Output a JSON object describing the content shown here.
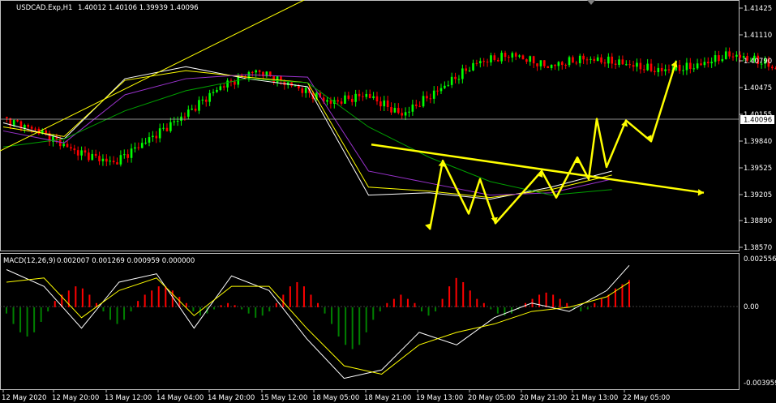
{
  "header": {
    "symbol_title": "USDCAD.Exp,H1",
    "ohlc_text": "1.40012 1.40106 1.39939 1.40096"
  },
  "macd_header": {
    "label": "MACD(12,26,9)",
    "values_text": "0.002007 0.001269 0.000959 0.000000"
  },
  "price_axis": {
    "ticks": [
      "1.41425",
      "1.41110",
      "1.40790",
      "1.40475",
      "1.40155",
      "1.39840",
      "1.39525",
      "1.39205",
      "1.38890",
      "1.38570"
    ],
    "current_price": "1.40096"
  },
  "macd_axis": {
    "ticks": [
      "0.002556",
      "0.00",
      "-0.003959"
    ]
  },
  "time_axis": {
    "labels": [
      "12 May 2020",
      "12 May 20:00",
      "13 May 12:00",
      "14 May 04:00",
      "14 May 20:00",
      "15 May 12:00",
      "18 May 05:00",
      "18 May 21:00",
      "19 May 13:00",
      "20 May 05:00",
      "20 May 21:00",
      "21 May 13:00",
      "22 May 05:00"
    ]
  },
  "colors": {
    "background": "#000000",
    "bull_candle": "#00ff00",
    "bear_candle": "#ff0000",
    "hist_positive": "#ff0000",
    "hist_negative": "#008000",
    "ma_fast": "#ffffff",
    "ma_mid": "#ffff00",
    "ma_purple": "#9932cc",
    "ma_slow": "#00a000",
    "annotation": "#ffff00",
    "axis_text": "#ffffff",
    "grid": "#c0c0c0"
  },
  "chart_data": [
    {
      "type": "candlestick",
      "title": "USDCAD.Exp,H1",
      "x_labels": [
        "12 May 2020",
        "12 May 20:00",
        "13 May 12:00",
        "14 May 04:00",
        "14 May 20:00",
        "15 May 12:00",
        "18 May 05:00",
        "18 May 21:00",
        "19 May 13:00",
        "20 May 05:00",
        "20 May 21:00",
        "21 May 13:00",
        "22 May 05:00"
      ],
      "ylim": [
        1.3845,
        1.4158
      ],
      "last_ohlc": {
        "open": 1.40012,
        "high": 1.40106,
        "low": 1.39939,
        "close": 1.40096
      },
      "close_path": [
        [
          0,
          1.401
        ],
        [
          2,
          1.3995
        ],
        [
          4,
          1.397
        ],
        [
          6,
          1.3955
        ],
        [
          8,
          1.3985
        ],
        [
          10,
          1.4015
        ],
        [
          12,
          1.405
        ],
        [
          14,
          1.407
        ],
        [
          16,
          1.405
        ],
        [
          18,
          1.403
        ],
        [
          20,
          1.404
        ],
        [
          22,
          1.4015
        ],
        [
          24,
          1.4045
        ],
        [
          26,
          1.408
        ],
        [
          28,
          1.409
        ],
        [
          30,
          1.4075
        ],
        [
          32,
          1.4085
        ],
        [
          34,
          1.408
        ],
        [
          36,
          1.407
        ],
        [
          38,
          1.4075
        ],
        [
          40,
          1.409
        ],
        [
          42,
          1.408
        ],
        [
          44,
          1.405
        ],
        [
          46,
          1.402
        ],
        [
          48,
          1.4015
        ],
        [
          50,
          1.403
        ],
        [
          52,
          1.402
        ],
        [
          54,
          1.4025
        ],
        [
          56,
          1.4015
        ],
        [
          58,
          1.404
        ],
        [
          60,
          1.4065
        ],
        [
          62,
          1.409
        ],
        [
          64,
          1.4105
        ],
        [
          66,
          1.4085
        ],
        [
          68,
          1.407
        ],
        [
          70,
          1.4065
        ],
        [
          72,
          1.4055
        ],
        [
          74,
          1.406
        ],
        [
          76,
          1.404
        ],
        [
          78,
          1.3985
        ],
        [
          80,
          1.395
        ],
        [
          82,
          1.3925
        ],
        [
          84,
          1.3935
        ],
        [
          86,
          1.3945
        ],
        [
          88,
          1.3915
        ],
        [
          90,
          1.3895
        ],
        [
          92,
          1.387
        ],
        [
          94,
          1.388
        ],
        [
          96,
          1.3955
        ],
        [
          98,
          1.394
        ],
        [
          100,
          1.3915
        ],
        [
          102,
          1.3925
        ],
        [
          104,
          1.393
        ],
        [
          106,
          1.392
        ],
        [
          108,
          1.3905
        ],
        [
          110,
          1.3885
        ],
        [
          112,
          1.3878
        ],
        [
          114,
          1.3895
        ],
        [
          116,
          1.3905
        ],
        [
          118,
          1.39
        ],
        [
          120,
          1.3915
        ],
        [
          122,
          1.393
        ],
        [
          124,
          1.3938
        ],
        [
          126,
          1.3925
        ],
        [
          128,
          1.391
        ],
        [
          130,
          1.39
        ],
        [
          132,
          1.393
        ],
        [
          134,
          1.3955
        ],
        [
          136,
          1.3948
        ],
        [
          138,
          1.3942
        ],
        [
          140,
          1.3955
        ],
        [
          142,
          1.396
        ],
        [
          144,
          1.3985
        ],
        [
          146,
          1.401
        ]
      ],
      "moving_averages": [
        {
          "color": "ma_fast",
          "points": [
            [
              0,
              1.4005
            ],
            [
              20,
              1.3985
            ],
            [
              40,
              1.406
            ],
            [
              60,
              1.4075
            ],
            [
              80,
              1.406
            ],
            [
              100,
              1.405
            ],
            [
              120,
              1.3915
            ],
            [
              140,
              1.3918
            ],
            [
              160,
              1.391
            ],
            [
              180,
              1.3925
            ],
            [
              200,
              1.3945
            ]
          ]
        },
        {
          "color": "ma_mid",
          "points": [
            [
              0,
              1.4
            ],
            [
              20,
              1.3988
            ],
            [
              40,
              1.4058
            ],
            [
              60,
              1.407
            ],
            [
              80,
              1.4062
            ],
            [
              100,
              1.4055
            ],
            [
              120,
              1.3925
            ],
            [
              140,
              1.392
            ],
            [
              160,
              1.3912
            ],
            [
              180,
              1.3922
            ],
            [
              200,
              1.394
            ]
          ]
        },
        {
          "color": "ma_purple",
          "points": [
            [
              0,
              1.3995
            ],
            [
              20,
              1.398
            ],
            [
              40,
              1.404
            ],
            [
              60,
              1.406
            ],
            [
              80,
              1.4065
            ],
            [
              100,
              1.4062
            ],
            [
              120,
              1.3945
            ],
            [
              140,
              1.393
            ],
            [
              160,
              1.3915
            ],
            [
              180,
              1.3918
            ],
            [
              200,
              1.3935
            ]
          ]
        },
        {
          "color": "ma_slow",
          "points": [
            [
              0,
              1.3975
            ],
            [
              20,
              1.3985
            ],
            [
              40,
              1.402
            ],
            [
              60,
              1.4045
            ],
            [
              80,
              1.406
            ],
            [
              100,
              1.4055
            ],
            [
              120,
              1.4
            ],
            [
              140,
              1.3962
            ],
            [
              160,
              1.3932
            ],
            [
              180,
              1.3915
            ],
            [
              200,
              1.3922
            ]
          ]
        }
      ],
      "trendlines": [
        {
          "color": "ma_mid",
          "from": [
            0,
            1.397
          ],
          "to": [
            77,
            1.4158
          ]
        },
        {
          "color": "annotation",
          "from": [
            94,
            1.3978
          ],
          "to": [
            178,
            1.3918
          ]
        }
      ],
      "wave_pattern": [
        [
          106,
          1.3872
        ],
        [
          112,
          1.3958
        ],
        [
          119,
          1.3892
        ],
        [
          123,
          1.3935
        ],
        [
          125,
          1.388
        ],
        [
          137,
          1.3945
        ],
        [
          141,
          1.3912
        ],
        [
          145,
          1.3962
        ],
        [
          150,
          1.3935
        ],
        [
          154,
          1.401
        ],
        [
          157,
          1.395
        ],
        [
          160,
          1.4008
        ],
        [
          165,
          1.3982
        ],
        [
          171,
          1.4082
        ]
      ],
      "horizontal_line": 1.40096
    },
    {
      "type": "bar",
      "title": "MACD(12,26,9)",
      "values_text": "0.002007 0.001269 0.000959 0.000000",
      "ylim": [
        -0.003959,
        0.002556
      ],
      "histogram": [
        -0.0003,
        -0.0008,
        -0.0012,
        -0.0014,
        -0.0012,
        -0.0007,
        -0.0002,
        0.0003,
        0.0006,
        0.0008,
        0.001,
        0.0009,
        0.0006,
        0.0002,
        -0.0002,
        -0.0006,
        -0.0008,
        -0.0006,
        -0.0002,
        0.0003,
        0.0006,
        0.0008,
        0.001,
        0.001,
        0.0008,
        0.0005,
        0.0002,
        -0.0002,
        -0.0004,
        -0.0003,
        -0.0001,
        0.0001,
        0.0002,
        0.0001,
        -0.0001,
        -0.0003,
        -0.0005,
        -0.0004,
        -0.0002,
        0.0002,
        0.0006,
        0.001,
        0.0012,
        0.001,
        0.0006,
        0.0002,
        -0.0003,
        -0.0008,
        -0.0014,
        -0.0018,
        -0.002,
        -0.0018,
        -0.0012,
        -0.0006,
        -0.0002,
        0.0002,
        0.0004,
        0.0006,
        0.0004,
        0.0002,
        -0.0002,
        -0.0004,
        -0.0002,
        0.0004,
        0.001,
        0.0014,
        0.0012,
        0.0008,
        0.0004,
        0.0002,
        -0.0001,
        -0.0003,
        -0.0004,
        -0.0003,
        -0.0001,
        0.0002,
        0.0004,
        0.0006,
        0.0007,
        0.0006,
        0.0004,
        0.0002,
        -0.0001,
        -0.0002,
        -0.0001,
        0.0002,
        0.0004,
        0.0006,
        0.0009,
        0.0011,
        0.0013
      ],
      "macd_line": [
        [
          0,
          0.0018
        ],
        [
          10,
          0.001
        ],
        [
          20,
          -0.001
        ],
        [
          30,
          0.0012
        ],
        [
          40,
          0.0016
        ],
        [
          50,
          -0.001
        ],
        [
          60,
          0.0015
        ],
        [
          70,
          0.0008
        ],
        [
          80,
          -0.0015
        ],
        [
          90,
          -0.0034
        ],
        [
          100,
          -0.003
        ],
        [
          110,
          -0.0012
        ],
        [
          120,
          -0.0018
        ],
        [
          130,
          -0.0005
        ],
        [
          140,
          0.0002
        ],
        [
          150,
          -0.0002
        ],
        [
          160,
          0.0008
        ],
        [
          166,
          0.002
        ]
      ],
      "signal_line": [
        [
          0,
          0.0012
        ],
        [
          10,
          0.0014
        ],
        [
          20,
          -0.0005
        ],
        [
          30,
          0.0008
        ],
        [
          40,
          0.0014
        ],
        [
          50,
          -0.0004
        ],
        [
          60,
          0.001
        ],
        [
          70,
          0.001
        ],
        [
          80,
          -0.001
        ],
        [
          90,
          -0.0028
        ],
        [
          100,
          -0.0032
        ],
        [
          110,
          -0.0018
        ],
        [
          120,
          -0.0012
        ],
        [
          130,
          -0.0008
        ],
        [
          140,
          -0.0002
        ],
        [
          150,
          0.0
        ],
        [
          160,
          0.0005
        ],
        [
          166,
          0.0012
        ]
      ]
    }
  ]
}
